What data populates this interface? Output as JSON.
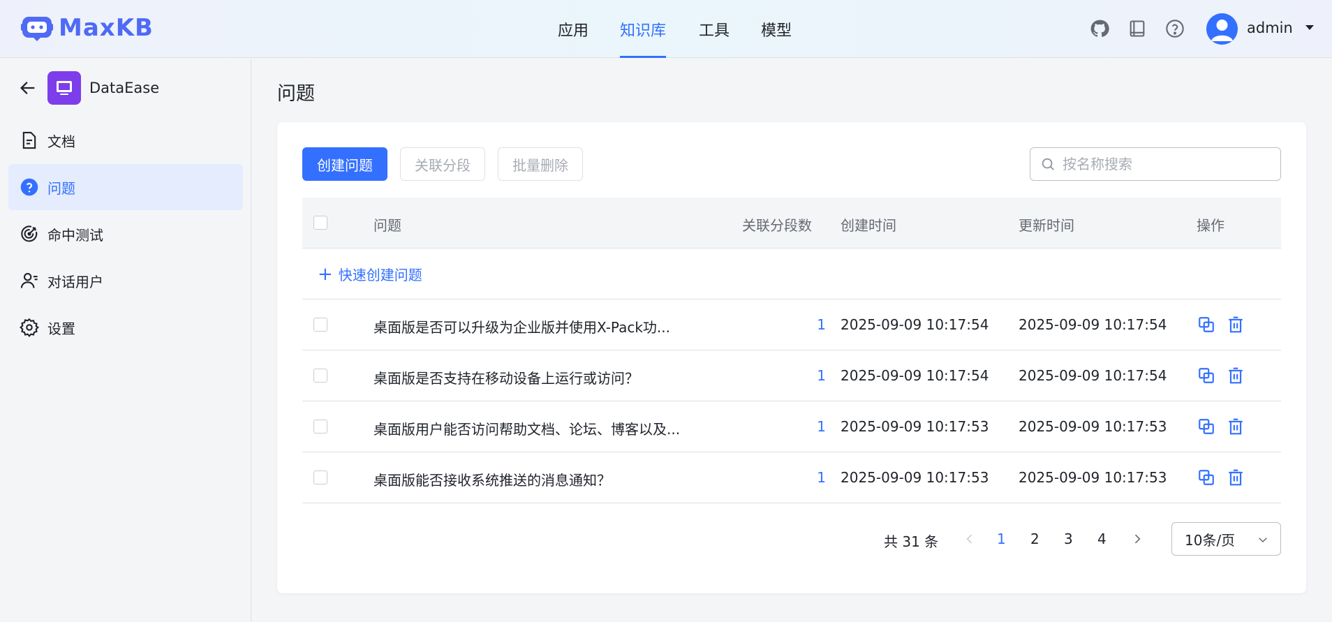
{
  "app": {
    "name": "MaxKB"
  },
  "nav": {
    "items": [
      "应用",
      "知识库",
      "工具",
      "模型"
    ],
    "active": "知识库"
  },
  "user": {
    "name": "admin"
  },
  "sidebar": {
    "kb_name": "DataEase",
    "items": [
      {
        "label": "文档",
        "icon": "document-icon"
      },
      {
        "label": "问题",
        "icon": "question-icon",
        "active": true
      },
      {
        "label": "命中测试",
        "icon": "target-icon"
      },
      {
        "label": "对话用户",
        "icon": "chat-user-icon"
      },
      {
        "label": "设置",
        "icon": "gear-icon"
      }
    ]
  },
  "page": {
    "title": "问题"
  },
  "toolbar": {
    "create_label": "创建问题",
    "link_label": "关联分段",
    "batch_delete_label": "批量删除",
    "search_placeholder": "按名称搜索"
  },
  "table": {
    "headers": [
      "问题",
      "关联分段数",
      "创建时间",
      "更新时间",
      "操作"
    ],
    "quick_create_label": "快速创建问题",
    "rows": [
      {
        "question": "桌面版是否可以升级为企业版并使用X-Pack功...",
        "count": "1",
        "created": "2025-09-09 10:17:54",
        "updated": "2025-09-09 10:17:54"
      },
      {
        "question": "桌面版是否支持在移动设备上运行或访问？",
        "count": "1",
        "created": "2025-09-09 10:17:54",
        "updated": "2025-09-09 10:17:54"
      },
      {
        "question": "桌面版用户能否访问帮助文档、论坛、博客以及...",
        "count": "1",
        "created": "2025-09-09 10:17:53",
        "updated": "2025-09-09 10:17:53"
      },
      {
        "question": "桌面版能否接收系统推送的消息通知？",
        "count": "1",
        "created": "2025-09-09 10:17:53",
        "updated": "2025-09-09 10:17:53"
      }
    ]
  },
  "pagination": {
    "total_label": "共 31 条",
    "pages": [
      "1",
      "2",
      "3",
      "4"
    ],
    "current": "1",
    "page_size_label": "10条/页"
  },
  "colors": {
    "accent": "#3370ff",
    "kb_icon": "#7d3dea",
    "logo": "#4f6af5"
  }
}
